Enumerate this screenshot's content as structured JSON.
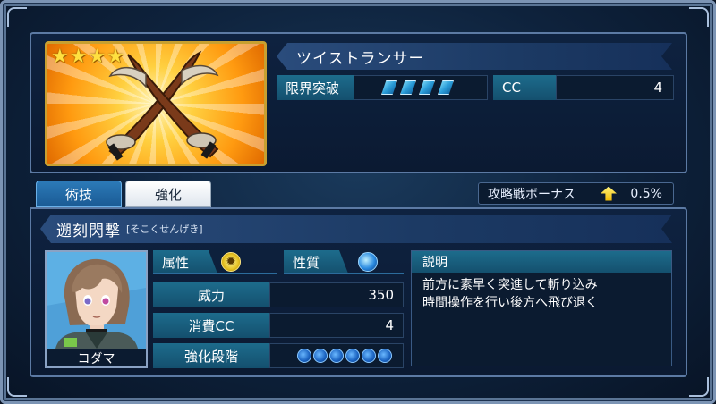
{
  "weapon": {
    "stars": 4,
    "name": "ツイストランサー",
    "limit_break_label": "限界突破",
    "limit_break_gems": 4,
    "cc_label": "CC",
    "cc_value": "4"
  },
  "tabs": [
    {
      "label": "術技",
      "active": true
    },
    {
      "label": "強化",
      "active": false
    }
  ],
  "bonus": {
    "label": "攻略戦ボーナス",
    "value": "0.5%"
  },
  "skill": {
    "name": "遡刻閃撃",
    "reading": "[そこくせんげき]",
    "attribute_label": "属性",
    "nature_label": "性質",
    "stats": [
      {
        "label": "威力",
        "value": "350"
      },
      {
        "label": "消費CC",
        "value": "4"
      },
      {
        "label": "強化段階",
        "value": ""
      }
    ],
    "enhance_level_max": 6,
    "description_label": "説明",
    "description_lines": [
      "前方に素早く突進して斬り込み",
      "時間操作を行い後方へ飛び退く"
    ]
  },
  "character": {
    "name": "コダマ"
  },
  "colors": {
    "accent_teal": "#1d6c8c",
    "gold": "#ffd040",
    "panel_bg": "#0b1a32"
  }
}
